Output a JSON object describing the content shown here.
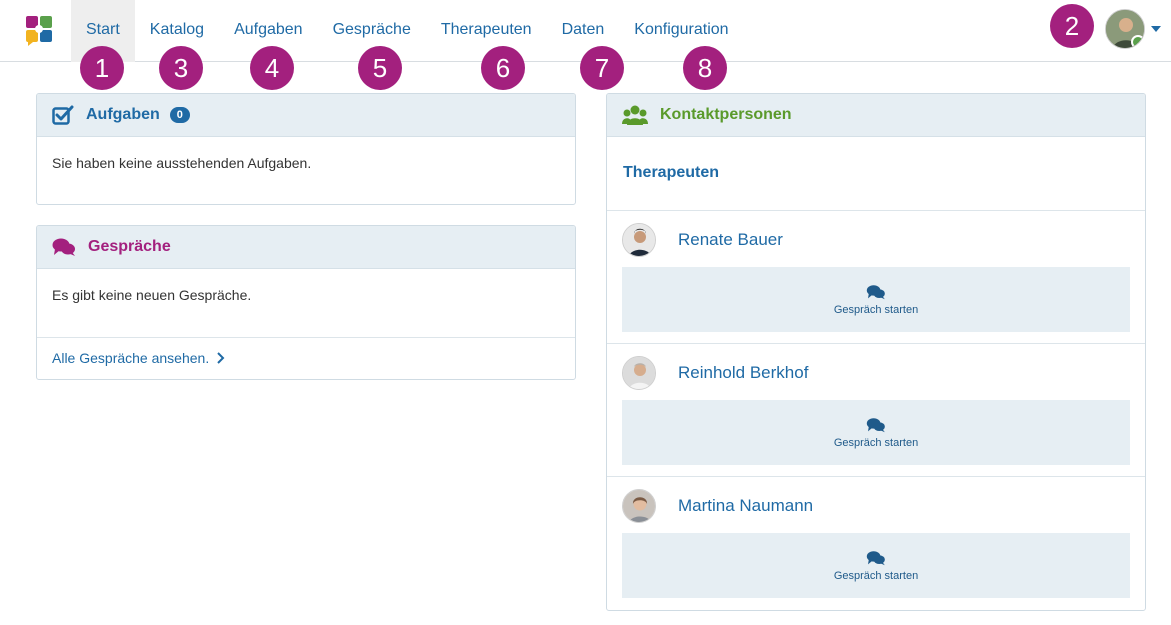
{
  "nav": {
    "items": [
      {
        "label": "Start",
        "active": true
      },
      {
        "label": "Katalog"
      },
      {
        "label": "Aufgaben"
      },
      {
        "label": "Gespräche"
      },
      {
        "label": "Therapeuten"
      },
      {
        "label": "Daten"
      },
      {
        "label": "Konfiguration"
      }
    ]
  },
  "markers": [
    "1",
    "2",
    "3",
    "4",
    "5",
    "6",
    "7",
    "8"
  ],
  "tasks": {
    "title": "Aufgaben",
    "count": "0",
    "message": "Sie haben keine ausstehenden Aufgaben."
  },
  "conversations": {
    "title": "Gespräche",
    "message": "Es gibt keine neuen Gespräche.",
    "link": "Alle Gespräche ansehen."
  },
  "contacts": {
    "title": "Kontaktpersonen",
    "section": "Therapeuten",
    "people": [
      {
        "name": "Renate Bauer",
        "action": "Gespräch starten"
      },
      {
        "name": "Reinhold Berkhof",
        "action": "Gespräch starten"
      },
      {
        "name": "Martina Naumann",
        "action": "Gespräch starten"
      }
    ]
  },
  "colors": {
    "accent": "#1f6aa5",
    "marker": "#a3207e",
    "tasks_title": "#1f6aa5",
    "conversations_title": "#a3207e",
    "contacts_title": "#5a9a2b",
    "panel_head": "#e6eef3"
  },
  "icons": {
    "tasks": "checkbox-icon",
    "conversations": "chat-bubbles-icon",
    "contacts": "users-icon",
    "chat": "chat-icon",
    "link": "chevron-right-icon"
  }
}
